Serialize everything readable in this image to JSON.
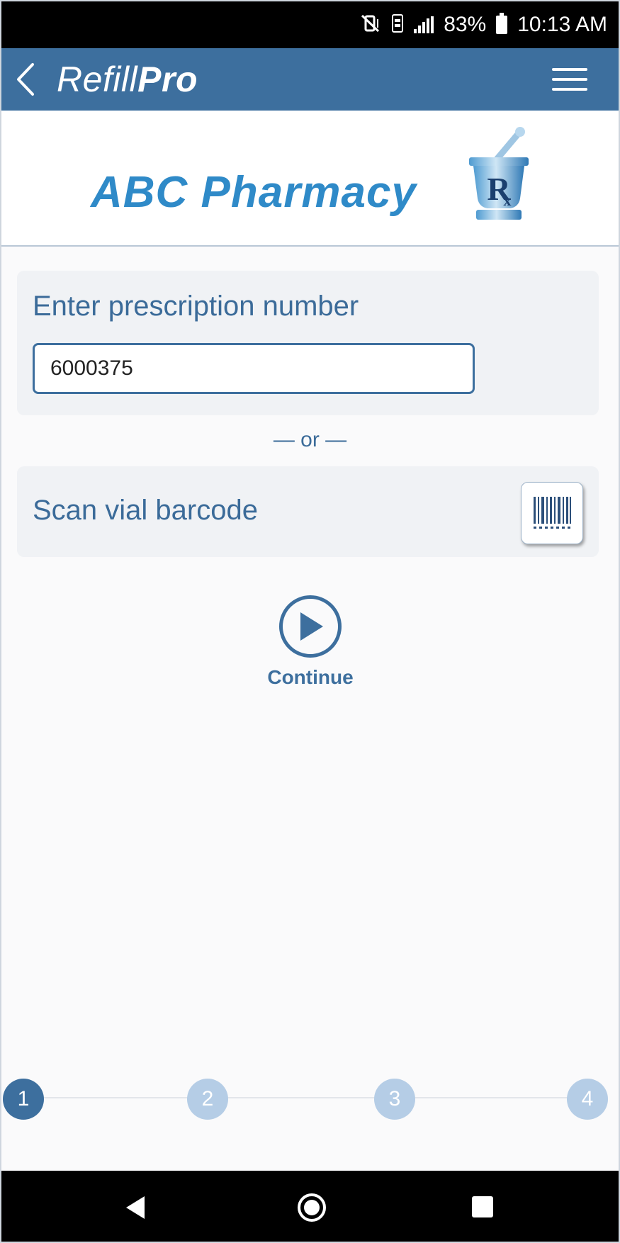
{
  "status_bar": {
    "battery_percent": "83%",
    "time": "10:13 AM",
    "icons": [
      "mute-vibrate-icon",
      "nfc-icon",
      "signal-icon",
      "battery-icon"
    ]
  },
  "header": {
    "title_light": "Refill",
    "title_bold": "Pro",
    "back_icon": "chevron-left-icon",
    "menu_icon": "hamburger-menu-icon"
  },
  "logo": {
    "pharmacy_name": "ABC Pharmacy",
    "emblem_icon": "mortar-pestle-rx-icon"
  },
  "prescription": {
    "title": "Enter prescription number",
    "input_value": "6000375"
  },
  "divider": "— or —",
  "scan": {
    "title": "Scan vial barcode",
    "icon": "barcode-icon"
  },
  "continue": {
    "label": "Continue",
    "icon": "play-circle-icon"
  },
  "stepper": {
    "steps": [
      "1",
      "2",
      "3",
      "4"
    ],
    "active_step": 1
  },
  "colors": {
    "primary": "#3d6f9e",
    "logo_blue": "#2f8ac8",
    "step_inactive": "#b5cde6"
  }
}
